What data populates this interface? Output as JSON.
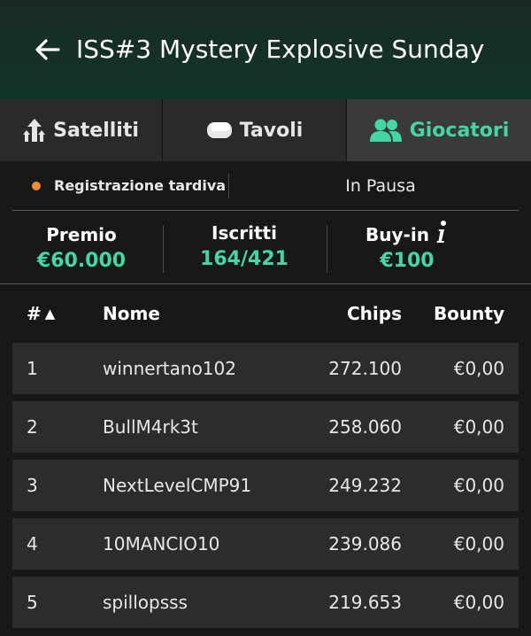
{
  "header": {
    "title": "ISS#3 Mystery Explosive Sunday"
  },
  "tabs": [
    {
      "label": "Satelliti",
      "icon": "satellite-arrows-icon"
    },
    {
      "label": "Tavoli",
      "icon": "table-icon"
    },
    {
      "label": "Giocatori",
      "icon": "players-icon",
      "active": true
    }
  ],
  "status": {
    "label": "Registrazione tardiva",
    "value": "In Pausa",
    "dot_color": "#ef8b32"
  },
  "stats": {
    "premio_label": "Premio",
    "premio_value": "€60.000",
    "iscritti_label": "Iscritti",
    "iscritti_value": "164/421",
    "buyin_label": "Buy-in",
    "buyin_value": "€100"
  },
  "table": {
    "headers": {
      "rank": "#",
      "sort_indicator": "▲",
      "nome": "Nome",
      "chips": "Chips",
      "bounty": "Bounty"
    },
    "rows": [
      {
        "rank": "1",
        "nome": "winnertano102",
        "chips": "272.100",
        "bounty": "€0,00"
      },
      {
        "rank": "2",
        "nome": "BullM4rk3t",
        "chips": "258.060",
        "bounty": "€0,00"
      },
      {
        "rank": "3",
        "nome": "NextLevelCMP91",
        "chips": "249.232",
        "bounty": "€0,00"
      },
      {
        "rank": "4",
        "nome": "10MANCIO10",
        "chips": "239.086",
        "bounty": "€0,00"
      },
      {
        "rank": "5",
        "nome": "spillopsss",
        "chips": "219.653",
        "bounty": "€0,00"
      }
    ]
  },
  "colors": {
    "accent": "#43d6a6",
    "header_bg": "#11342b",
    "row_bg": "#2c2c2c"
  }
}
